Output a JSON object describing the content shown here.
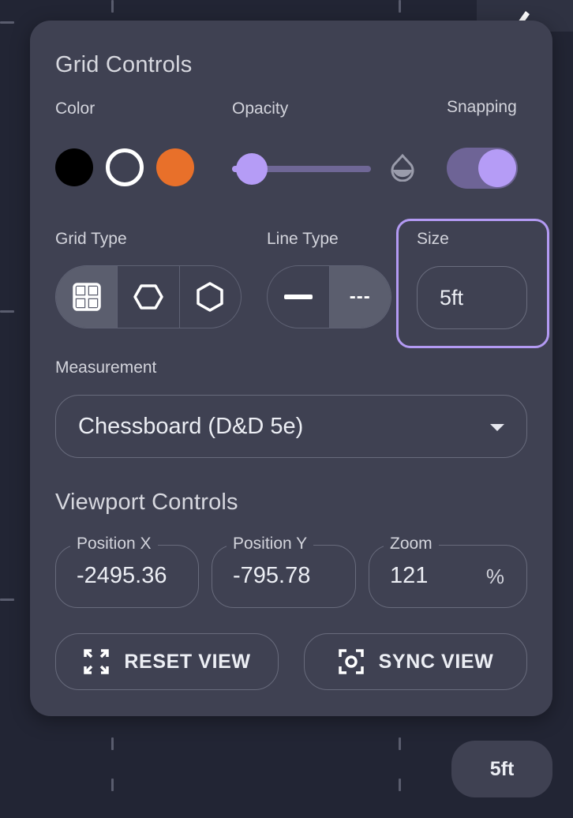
{
  "grid": {
    "title": "Grid Controls",
    "color_label": "Color",
    "opacity_label": "Opacity",
    "snapping_label": "Snapping",
    "colors": [
      "#000000",
      "#ffffff",
      "#e8702a"
    ],
    "selected_color": "#ffffff",
    "opacity_value": 0.14,
    "snapping_on": true,
    "grid_type_label": "Grid Type",
    "grid_type_options": [
      "square-grid-icon",
      "hex-horizontal-icon",
      "hex-vertical-icon"
    ],
    "grid_type_selected": "square-grid-icon",
    "line_type_label": "Line Type",
    "line_type_options": [
      "solid-line-icon",
      "dashed-line-icon"
    ],
    "line_type_selected": "dashed-line-icon",
    "line_type_dashed_text": "---",
    "size_label": "Size",
    "size_value": "5ft",
    "measurement_label": "Measurement",
    "measurement_value": "Chessboard (D&D 5e)"
  },
  "viewport": {
    "title": "Viewport Controls",
    "position_x_label": "Position X",
    "position_x_value": "-2495.36",
    "position_y_label": "Position Y",
    "position_y_value": "-795.78",
    "zoom_label": "Zoom",
    "zoom_value": "121",
    "zoom_suffix": "%",
    "reset_label": "RESET VIEW",
    "sync_label": "SYNC VIEW"
  },
  "scale_chip": "5ft",
  "theme": {
    "accent": "#b39af3",
    "panel_bg": "#3f4152",
    "page_bg": "#222534"
  }
}
